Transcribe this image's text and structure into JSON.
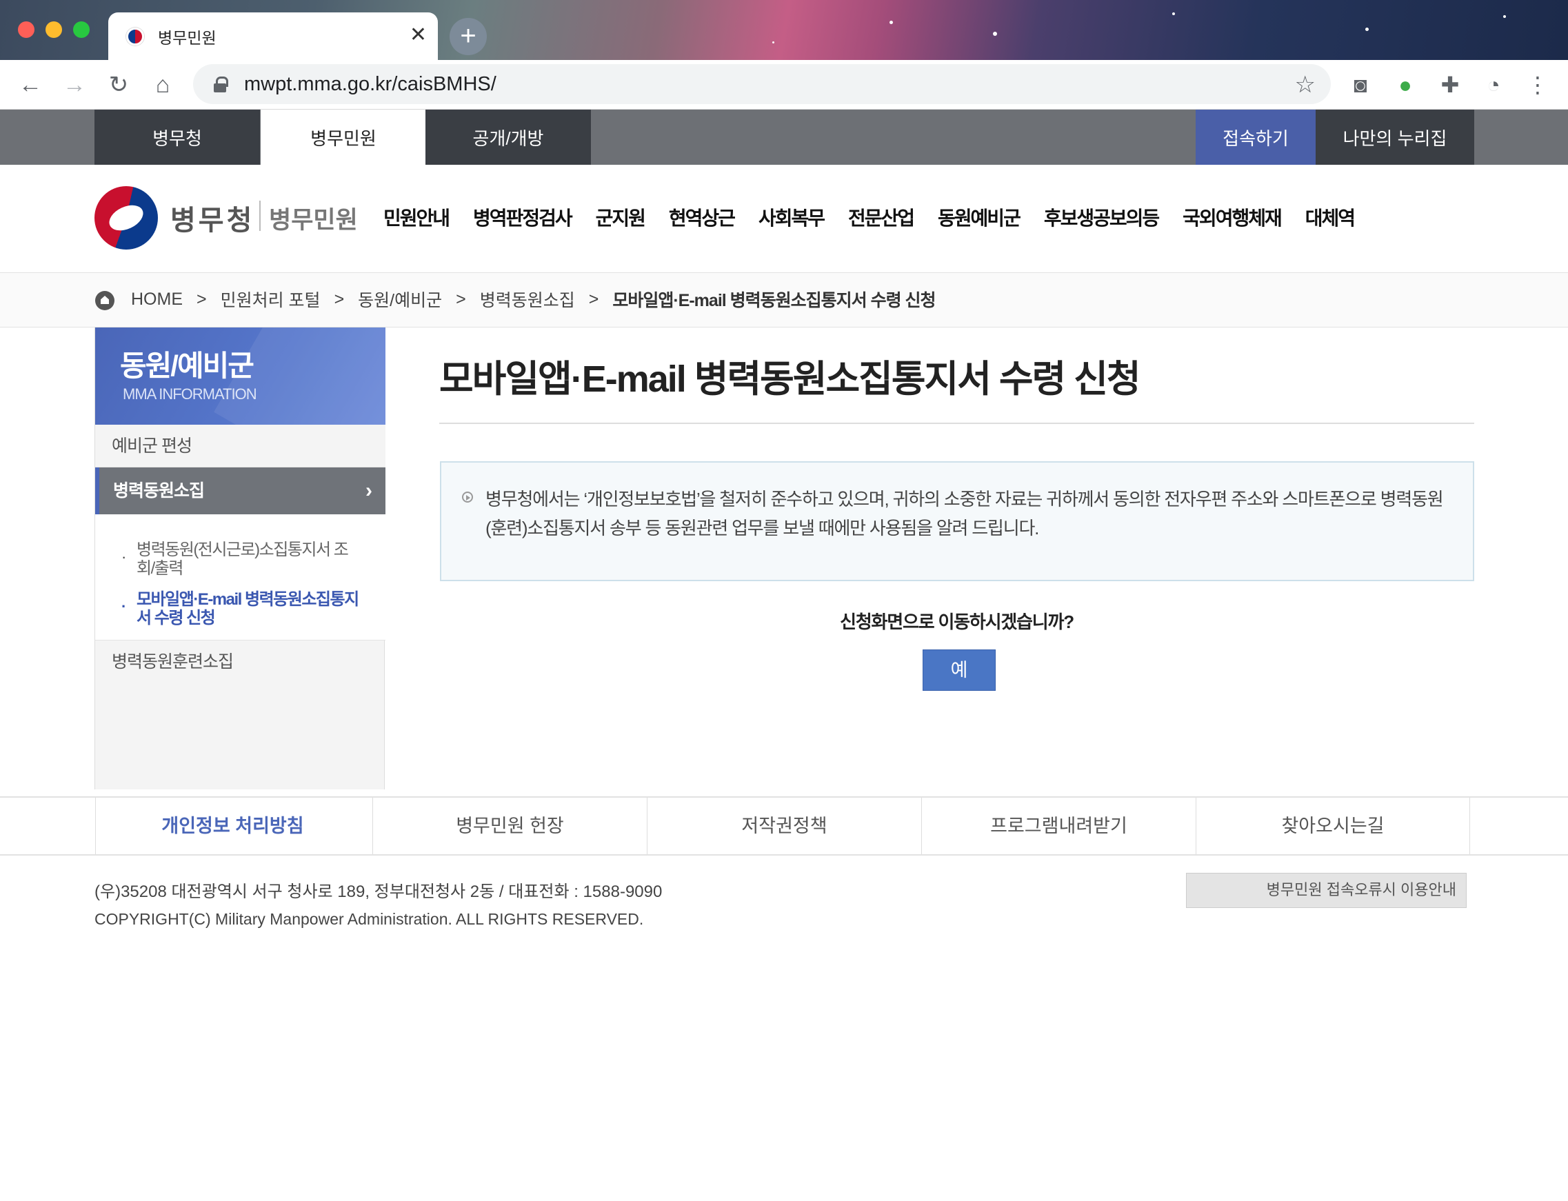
{
  "browser": {
    "tab_title": "병무민원",
    "tab_close": "✕",
    "new_tab": "+",
    "url": "mwpt.mma.go.kr/caisBMHS/"
  },
  "top_tabs": [
    {
      "label": "병무청"
    },
    {
      "label": "병무민원"
    },
    {
      "label": "공개/개방"
    }
  ],
  "top_right": {
    "login": "접속하기",
    "nuri": "나만의 누리집"
  },
  "logo": {
    "main": "병무청",
    "sub": "병무민원"
  },
  "main_menu": [
    "민원안내",
    "병역판정검사",
    "군지원",
    "현역상근",
    "사회복무",
    "전문산업",
    "동원예비군",
    "후보생공보의등",
    "국외여행체재",
    "대체역"
  ],
  "breadcrumb": {
    "home": "HOME",
    "items": [
      "민원처리 포털",
      "동원/예비군",
      "병력동원소집"
    ],
    "current": "모바일앱·E-mail 병력동원소집통지서 수령 신청",
    "separator": ">"
  },
  "lnb": {
    "title": "동원/예비군",
    "subtitle": "MMA INFORMATION",
    "items": [
      {
        "label": "예비군 편성"
      },
      {
        "label": "병력동원소집"
      },
      {
        "label": "병력동원훈련소집"
      }
    ],
    "active_chevron": "›",
    "subitems": [
      {
        "label": "병력동원(전시근로)소집통지서 조회/출력"
      },
      {
        "label": "모바일앱·E-mail 병력동원소집통지서 수령 신청"
      }
    ]
  },
  "content": {
    "title": "모바일앱·E-mail 병력동원소집통지서 수령 신청",
    "notice": "병무청에서는 ‘개인정보보호법’을 철저히 준수하고 있으며, 귀하의 소중한 자료는 귀하께서 동의한 전자우편 주소와 스마트폰으로 병력동원(훈련)소집통지서 송부 등 동원관련 업무를 보낼 때에만 사용됨을 알려 드립니다.",
    "question": "신청화면으로 이동하시겠습니까?",
    "yes_button": "예"
  },
  "footer": {
    "links": [
      "개인정보 처리방침",
      "병무민원 헌장",
      "저작권정책",
      "프로그램내려받기",
      "찾아오시는길"
    ],
    "address": "(우)35208 대전광역시 서구 청사로 189, 정부대전청사 2동 / 대표전화 : 1588-9090",
    "copyright": "COPYRIGHT(C) Military Manpower Administration. ALL RIGHTS RESERVED.",
    "guide_button": "병무민원 접속오류시 이용안내"
  },
  "colors": {
    "accent_blue": "#4a66b8",
    "button_blue": "#4a76c5",
    "top_bar": "#6d7075",
    "dark_tab": "#3a3e44"
  }
}
